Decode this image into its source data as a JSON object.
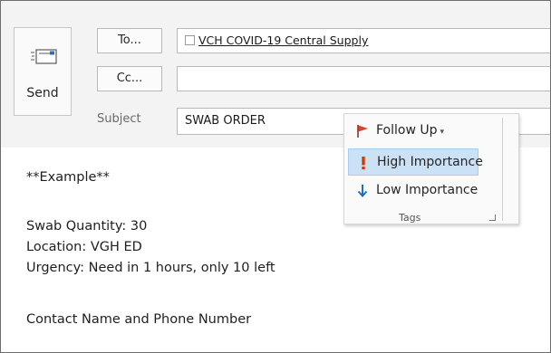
{
  "send": {
    "label": "Send",
    "icon": "send-envelope-icon"
  },
  "header": {
    "to_label": "To...",
    "cc_label": "Cc...",
    "subject_label": "Subject",
    "to_recipient": "VCH COVID-19 Central Supply",
    "cc_value": "",
    "subject_value": "SWAB ORDER"
  },
  "menu": {
    "items": [
      {
        "label": "Follow Up",
        "icon": "flag-icon",
        "caret": "▾",
        "color": "#d9442e"
      },
      {
        "label": "High Importance",
        "icon": "exclamation-icon",
        "color": "#d83b01",
        "selected": true
      },
      {
        "label": "Low Importance",
        "icon": "down-arrow-icon",
        "color": "#1f6fc5"
      }
    ],
    "group_label": "Tags"
  },
  "body": {
    "lines": [
      "**Example**",
      "Swab Quantity: 30",
      "Location: VGH ED",
      "Urgency: Need in 1 hours, only 10 left",
      "Contact Name and Phone Number"
    ]
  },
  "colors": {
    "highlight": "#cbe1f6",
    "header_bg": "#f3f3f3"
  }
}
